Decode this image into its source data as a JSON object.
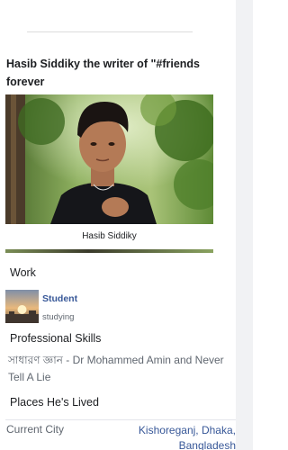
{
  "post": {
    "title": "Hasib Siddiky the writer of \"#friends forever"
  },
  "photo": {
    "caption": "Hasib Siddiky"
  },
  "work": {
    "heading": "Work",
    "item_title": "Student",
    "item_subtitle": "studying"
  },
  "skills": {
    "heading": "Professional Skills",
    "text": "সাধারণ জ্ঞান - Dr Mohammed Amin and Never Tell A Lie"
  },
  "places": {
    "heading": "Places He's Lived",
    "label": "Current City",
    "value": "Kishoreganj, Dhaka, Bangladesh"
  },
  "colors": {
    "link": "#385898",
    "text": "#1c1e21",
    "muted": "#606770"
  }
}
